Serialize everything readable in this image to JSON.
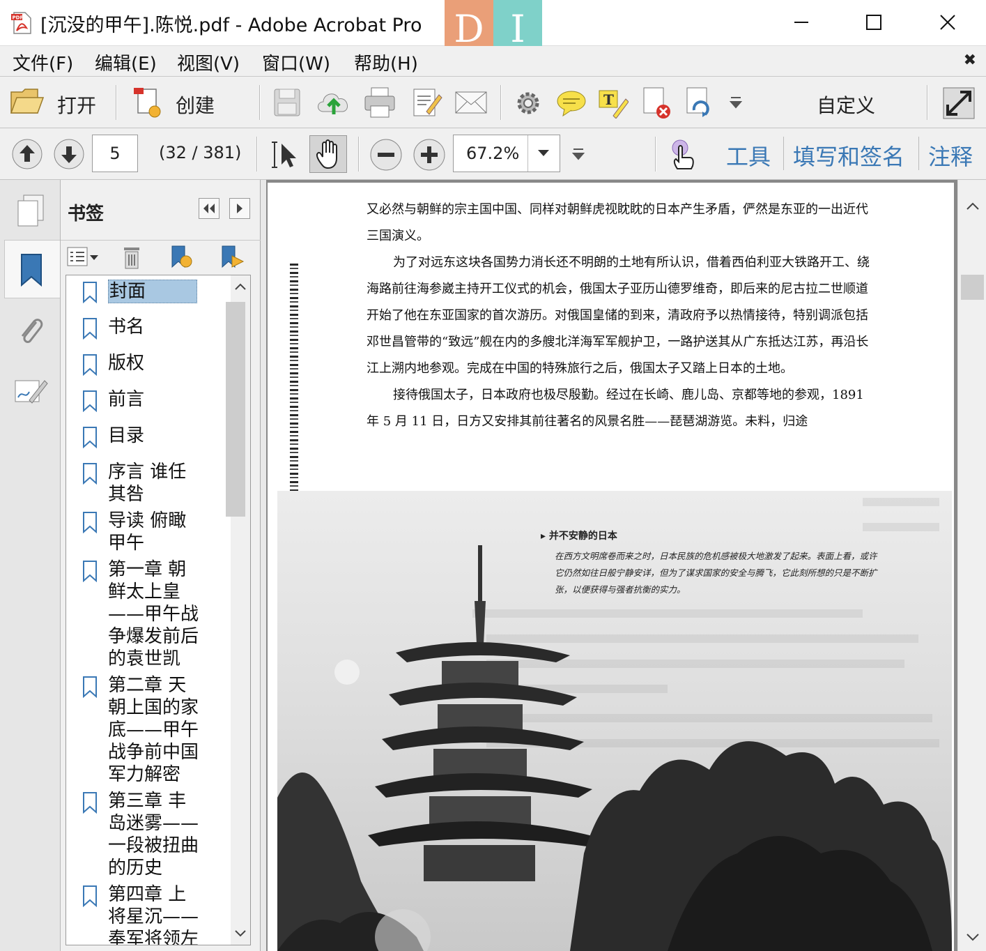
{
  "window": {
    "title": "[沉没的甲午].陈悦.pdf - Adobe Acrobat Pro",
    "watermark": [
      "D",
      "I"
    ]
  },
  "menu": [
    "文件(F)",
    "编辑(E)",
    "视图(V)",
    "窗口(W)",
    "帮助(H)"
  ],
  "toolbar": {
    "open_label": "打开",
    "create_label": "创建",
    "customize_label": "自定义"
  },
  "nav": {
    "page_number": "5",
    "page_count": "(32 / 381)",
    "zoom": "67.2%"
  },
  "right_tabs": [
    "工具",
    "填写和签名",
    "注释"
  ],
  "bookmarks": {
    "title": "书签",
    "items": [
      "封面",
      "书名",
      "版权",
      "前言",
      "目录",
      "序言 谁任其咎",
      "导读 俯瞰甲午",
      "第一章 朝鲜太上皇——甲午战争爆发前后的袁世凯",
      "第二章 天朝上国的家底——甲午战争前中国军力解密",
      "第三章 丰岛迷雾——一段被扭曲的历史",
      "第四章 上将星沉——奉军将领左"
    ]
  },
  "document": {
    "paragraphs": [
      "又必然与朝鲜的宗主国中国、同样对朝鲜虎视眈眈的日本产生矛盾，俨然是东亚的一出近代三国演义。",
      "为了对远东这块各国势力消长还不明朗的土地有所认识，借着西伯利亚大铁路开工、绕海路前往海参崴主持开工仪式的机会，俄国太子亚历山德罗维奇，即后来的尼古拉二世顺道开始了他在东亚国家的首次游历。对俄国皇储的到来，清政府予以热情接待，特别调派包括邓世昌管带的“致远”舰在内的多艘北洋海军军舰护卫，一路护送其从广东抵达江苏，再沿长江上溯内地参观。完成在中国的特殊旅行之后，俄国太子又踏上日本的土地。",
      "接待俄国太子，日本政府也极尽殷勤。经过在长崎、鹿儿岛、京都等地的参观，1891 年 5 月 11 日，日方又安排其前往著名的风景名胜——琵琶湖游览。未料，归途"
    ],
    "caption_title": "并不安静的日本",
    "caption_body": "在西方文明席卷而来之时，日本民族的危机感被极大地激发了起来。表面上看，或许它仍然如往日般宁静安详，但为了谋求国家的安全与腾飞，它此刻所想的只是不断扩张，以便获得与强者抗衡的实力。"
  }
}
